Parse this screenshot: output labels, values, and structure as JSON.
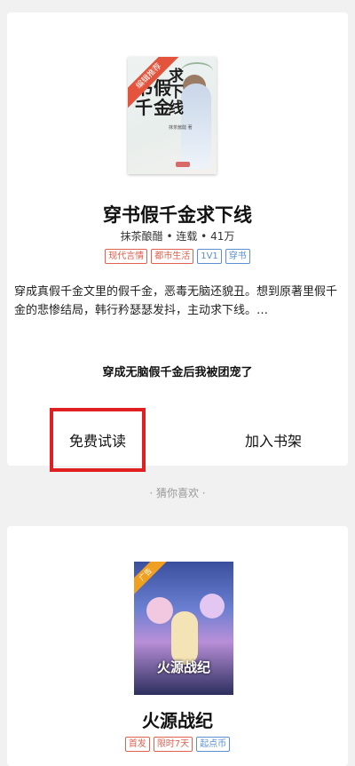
{
  "book": {
    "cover": {
      "ribbon": "编辑推荐",
      "title_lines": [
        "书假",
        "千金"
      ],
      "title_side": "求下线",
      "author": "抹茶酱醋 著"
    },
    "title": "穿书假千金求下线",
    "meta": "抹茶酿醋  •  连载  •  41万",
    "tags": [
      {
        "label": "现代言情",
        "color": "#e0614f"
      },
      {
        "label": "都市生活",
        "color": "#e0614f"
      },
      {
        "label": "1V1",
        "color": "#5a8fd1"
      },
      {
        "label": "穿书",
        "color": "#5a8fd1"
      }
    ],
    "description": "穿成真假千金文里的假千金，恶毒无脑还貌丑。想到原著里假千金的悲惨结局，韩行矜瑟瑟发抖，主动求下线。…",
    "chapter_title": "穿成无脑假千金后我被团宠了"
  },
  "actions": {
    "free_read": "免费试读",
    "add_shelf": "加入书架"
  },
  "divider": "· 猜你喜欢 ·",
  "recommendation": {
    "ad_label": "广告",
    "cover_logo": "火源战纪",
    "title": "火源战纪",
    "tags": [
      {
        "label": "首发",
        "color": "#e0614f"
      },
      {
        "label": "限时7天",
        "color": "#e0614f"
      },
      {
        "label": "起点币",
        "color": "#5a8fd1"
      }
    ]
  }
}
